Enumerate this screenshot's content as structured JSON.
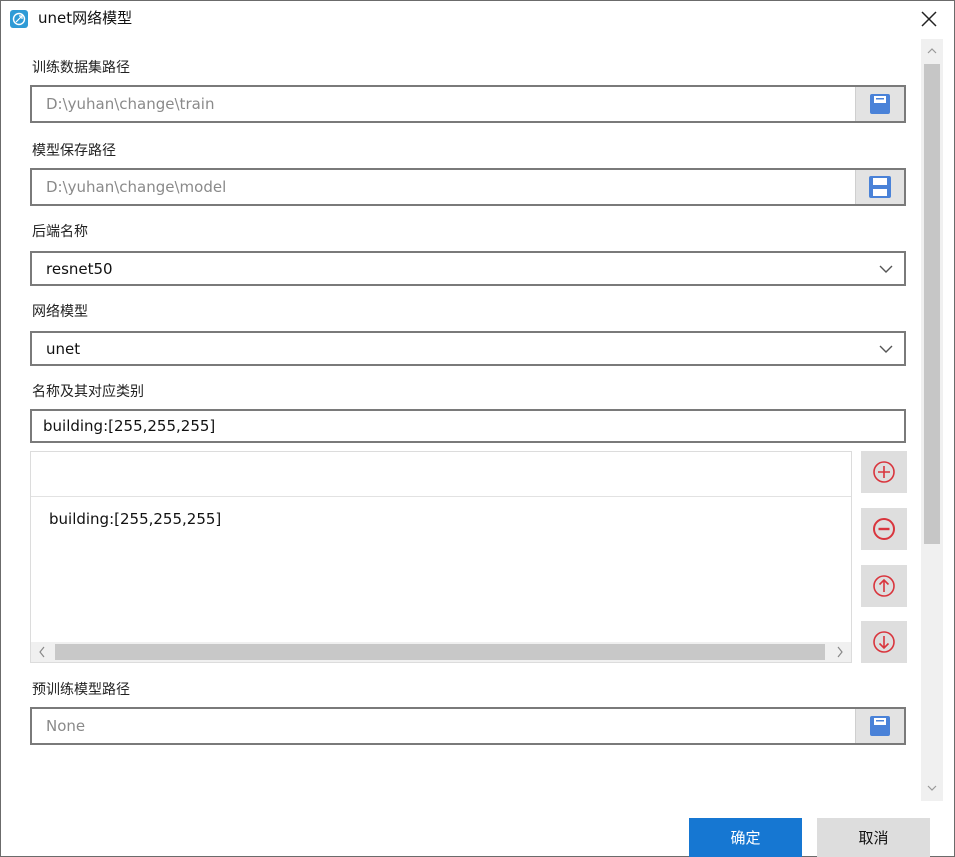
{
  "window": {
    "title": "unet网络模型"
  },
  "fields": {
    "train_path": {
      "label": "训练数据集路径",
      "value": "D:\\yuhan\\change\\train"
    },
    "model_save_path": {
      "label": "模型保存路径",
      "value": "D:\\yuhan\\change\\model"
    },
    "backend": {
      "label": "后端名称",
      "value": "resnet50"
    },
    "network": {
      "label": "网络模型",
      "value": "unet"
    },
    "classes": {
      "label": "名称及其对应类别",
      "input_value": "building:[255,255,255]",
      "items": [
        "building:[255,255,255]"
      ]
    },
    "pretrained_path": {
      "label": "预训练模型路径",
      "value": "None"
    }
  },
  "buttons": {
    "ok": "确定",
    "cancel": "取消"
  },
  "icons": {
    "app": "leaf-icon",
    "browse": "save-icon",
    "add": "plus-circle-icon",
    "remove": "minus-circle-icon",
    "up": "arrow-up-circle-icon",
    "down": "arrow-down-circle-icon"
  },
  "colors": {
    "primary": "#1677d2",
    "danger_icon": "#d9353d",
    "save_icon": "#4a82d8"
  }
}
